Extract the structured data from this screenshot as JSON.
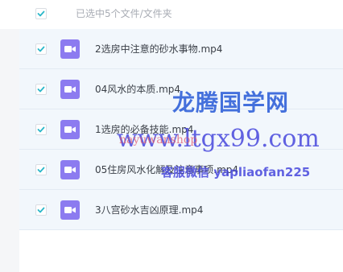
{
  "header": {
    "selection_label": "已选中5个文件/文件夹",
    "select_all_checked": true
  },
  "files": [
    {
      "name": "2选房中注意的砂水事物.mp4",
      "checked": true,
      "icon": "video-icon"
    },
    {
      "name": "04风水的本质.mp4",
      "checked": true,
      "icon": "video-icon"
    },
    {
      "name": "1选房的必备技能.mp4",
      "checked": true,
      "icon": "video-icon"
    },
    {
      "name": "05住房风水化解及注意事项.mp4",
      "checked": true,
      "icon": "video-icon"
    },
    {
      "name": "3八宫砂水吉凶原理.mp4",
      "checked": true,
      "icon": "video-icon"
    }
  ],
  "watermarks": {
    "brand": "龙腾国学网",
    "site": "www.ltgx99.com",
    "overlay": "nayuwanshop",
    "wechat": "客服微信 yapliaofan225"
  },
  "colors": {
    "checkmark": "#2ab7c9",
    "file_icon_bg": "#8c7bf0",
    "row_bg": "#f2f7fc"
  }
}
